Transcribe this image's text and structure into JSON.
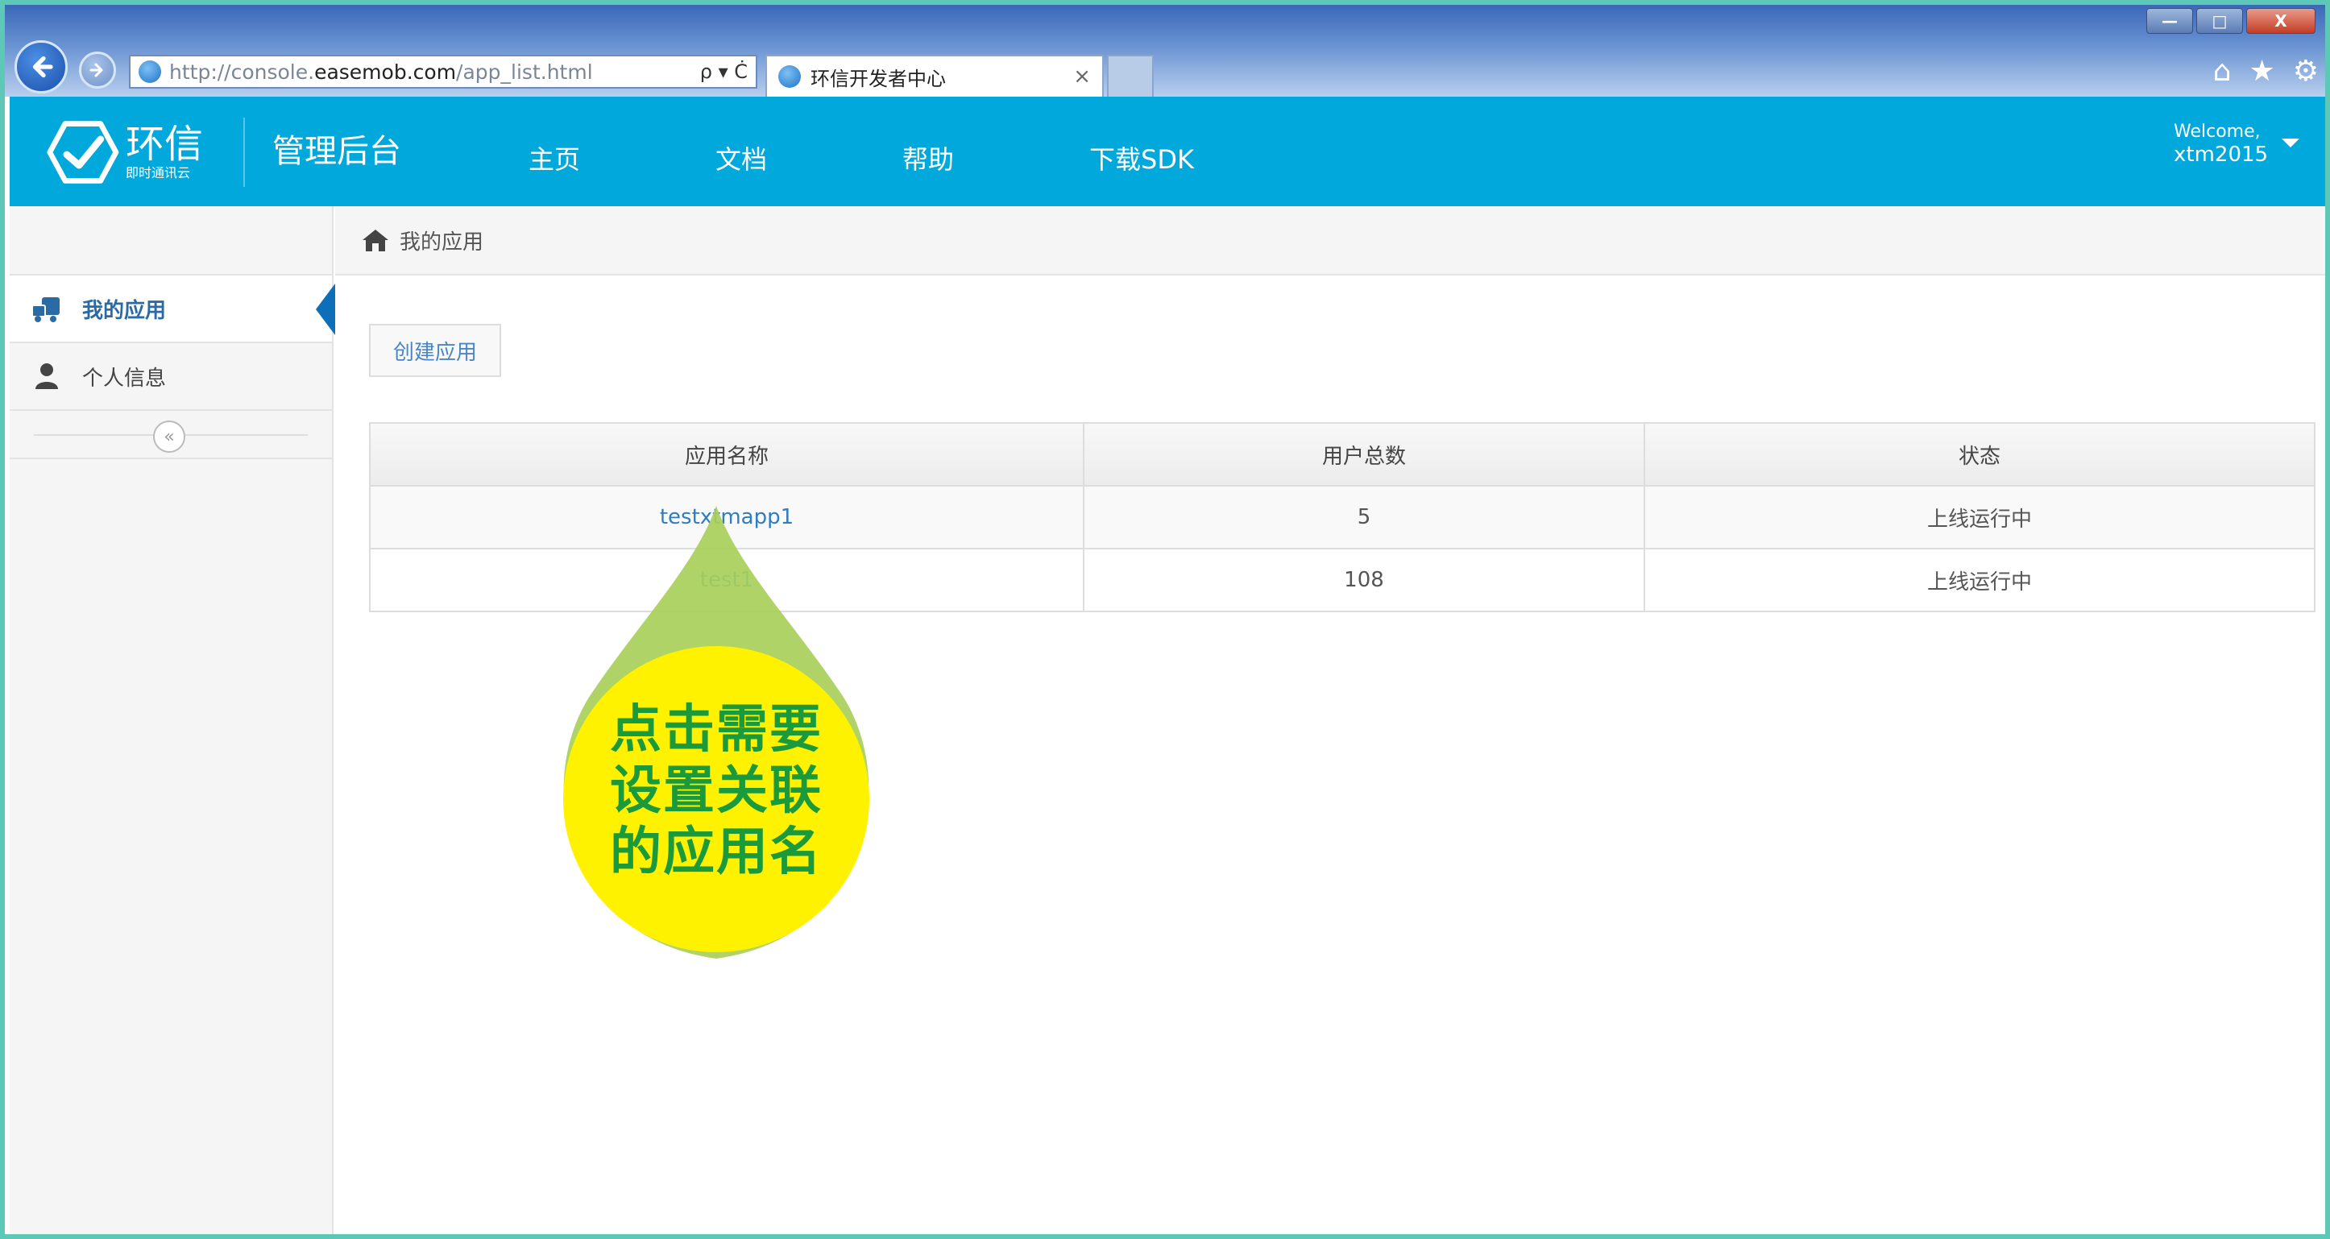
{
  "browser": {
    "address_prefix": "http://console.",
    "address_domain": "easemob.com",
    "address_path": "/app_list.html",
    "address_tools": "ρ ▾ Ċ",
    "tab_title": "环信开发者中心",
    "tab_close": "×",
    "win_min": "—",
    "win_max": "□",
    "win_close": "X",
    "tools": [
      "⌂",
      "★",
      "⚙"
    ]
  },
  "header": {
    "logo_main": "环信",
    "logo_sub": "即时通讯云",
    "title": "管理后台",
    "nav": [
      "主页",
      "文档",
      "帮助",
      "下载SDK"
    ],
    "welcome_line1": "Welcome,",
    "welcome_line2": "xtm2015"
  },
  "sidebar": {
    "items": [
      {
        "label": "我的应用",
        "icon": "apps-icon",
        "active": true
      },
      {
        "label": "个人信息",
        "icon": "user-icon",
        "active": false
      }
    ],
    "collapse_glyph": "«"
  },
  "breadcrumb": {
    "text": "我的应用",
    "icon": "home-icon"
  },
  "main": {
    "create_button": "创建应用",
    "table": {
      "headers": [
        "应用名称",
        "用户总数",
        "状态"
      ],
      "rows": [
        {
          "name": "testxtmapp1",
          "users": "5",
          "status": "上线运行中"
        },
        {
          "name": "test1",
          "users": "108",
          "status": "上线运行中"
        }
      ]
    }
  },
  "callout": {
    "line1": "点击需要",
    "line2": "设置关联",
    "line3": "的应用名",
    "fill_outer": "#a8cf5a",
    "fill_inner": "#fff200",
    "text_color": "#1a9a3a"
  },
  "colors": {
    "header_bg": "#00a8db",
    "link": "#2f7dc0",
    "active_marker": "#0d6fb8"
  }
}
